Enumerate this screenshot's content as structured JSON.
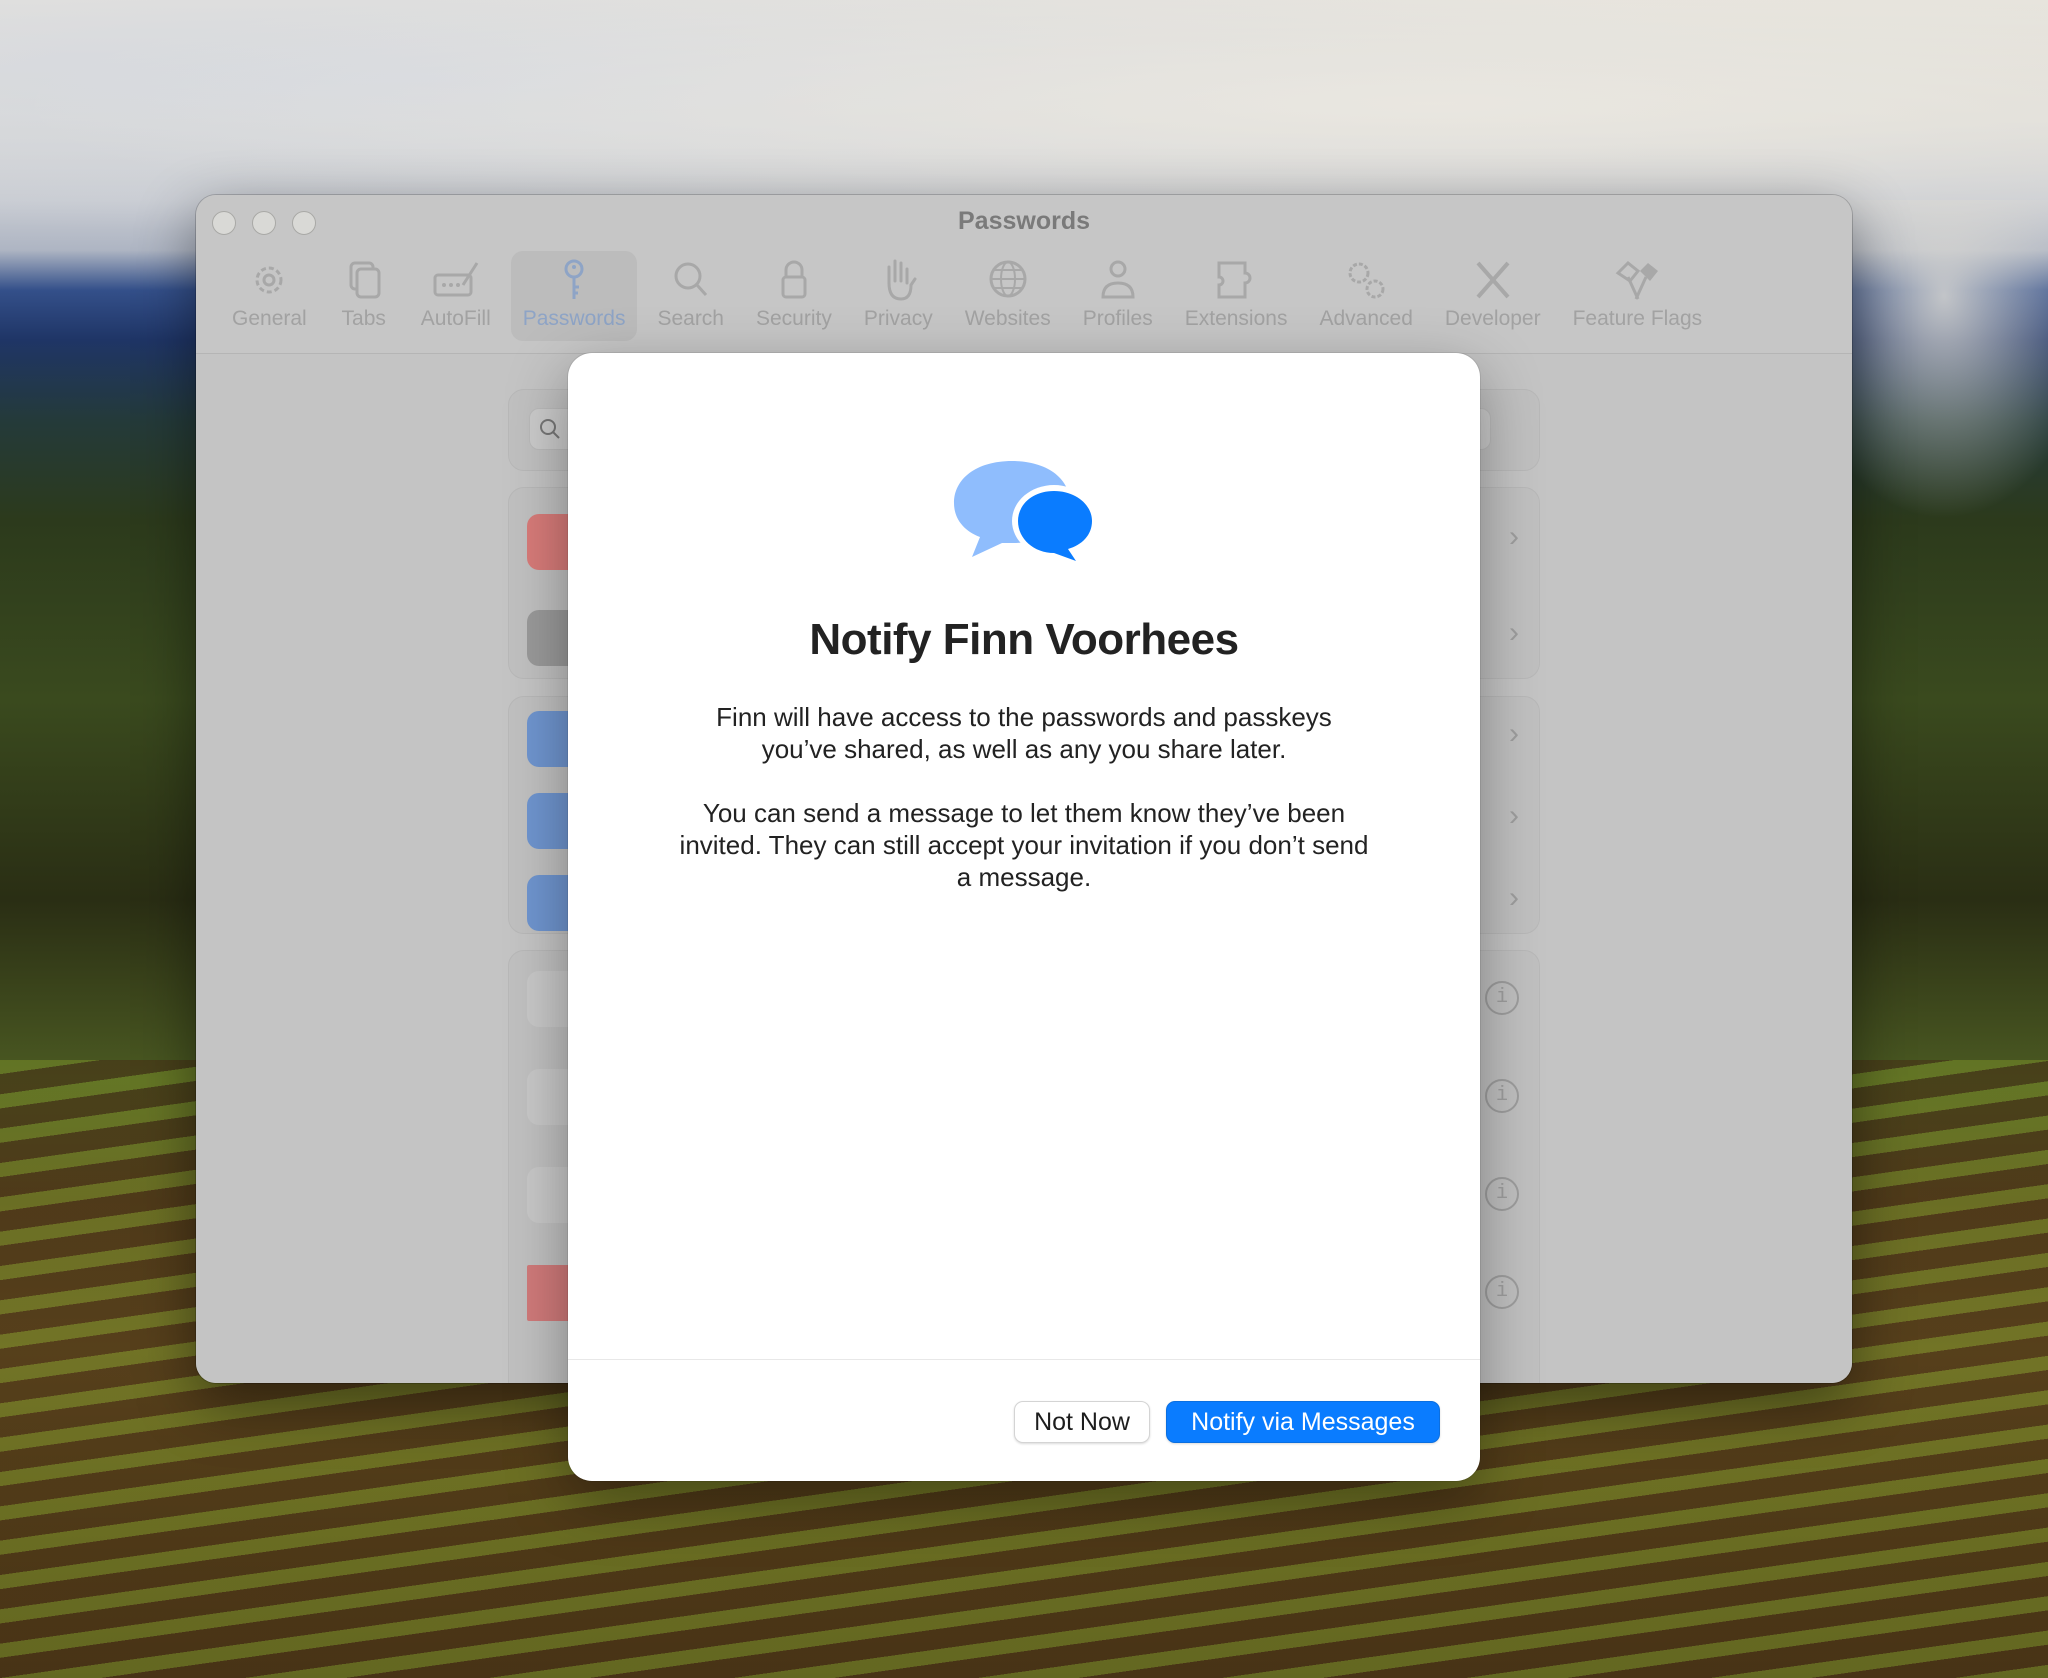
{
  "window": {
    "title": "Passwords",
    "toolbar": [
      {
        "label": "General",
        "icon": "gear-icon",
        "active": false
      },
      {
        "label": "Tabs",
        "icon": "tabs-icon",
        "active": false
      },
      {
        "label": "AutoFill",
        "icon": "autofill-icon",
        "active": false
      },
      {
        "label": "Passwords",
        "icon": "key-icon",
        "active": true
      },
      {
        "label": "Search",
        "icon": "search-icon",
        "active": false
      },
      {
        "label": "Security",
        "icon": "lock-icon",
        "active": false
      },
      {
        "label": "Privacy",
        "icon": "hand-icon",
        "active": false
      },
      {
        "label": "Websites",
        "icon": "globe-icon",
        "active": false
      },
      {
        "label": "Profiles",
        "icon": "person-icon",
        "active": false
      },
      {
        "label": "Extensions",
        "icon": "puzzle-icon",
        "active": false
      },
      {
        "label": "Advanced",
        "icon": "gears-icon",
        "active": false
      },
      {
        "label": "Developer",
        "icon": "tools-icon",
        "active": false
      },
      {
        "label": "Feature Flags",
        "icon": "flags-icon",
        "active": false
      }
    ],
    "background_list": {
      "search_chevron": "⌄",
      "rows_chevron": "›",
      "info_glyph": "i"
    }
  },
  "sheet": {
    "icon": "chat-bubbles-icon",
    "title": "Notify Finn Voorhees",
    "paragraph1": "Finn will have access to the passwords and passkeys you’ve shared, as well as any you share later.",
    "paragraph2": "You can send a message to let them know they’ve been invited. They can still accept your invitation if you don’t send a message.",
    "buttons": {
      "secondary": "Not Now",
      "primary": "Notify via Messages"
    },
    "colors": {
      "primary_button": "#0a7cff",
      "bubble_light": "#8fbdfd",
      "bubble_dark": "#0a7cff"
    }
  }
}
